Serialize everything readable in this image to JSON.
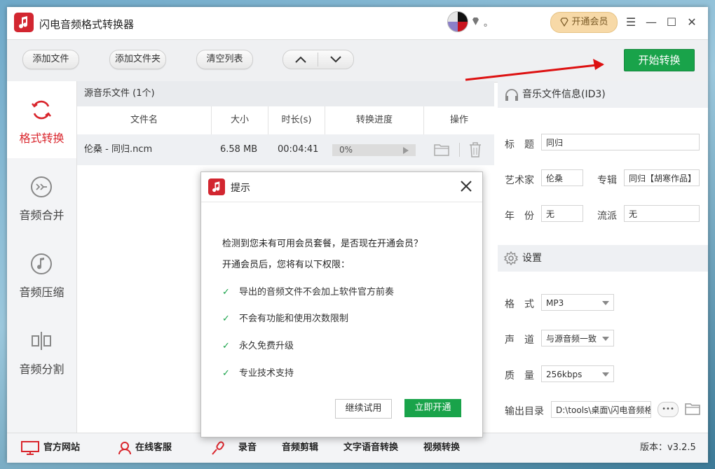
{
  "app": {
    "title": "闪电音频格式转换器",
    "user_name": "。",
    "open_vip_label": "开通会员"
  },
  "window_controls": {
    "menu": "☰",
    "minimize": "—",
    "maximize": "☐",
    "close": "✕"
  },
  "toolbar": {
    "add_file": "添加文件",
    "add_folder": "添加文件夹",
    "clear_list": "清空列表",
    "start_convert": "开始转换"
  },
  "sidebar": {
    "items": [
      {
        "label": "格式转换",
        "icon": "refresh-icon",
        "active": true
      },
      {
        "label": "音频合并",
        "icon": "merge-icon",
        "active": false
      },
      {
        "label": "音频压缩",
        "icon": "music-note-icon",
        "active": false
      },
      {
        "label": "音频分割",
        "icon": "split-icon",
        "active": false
      }
    ]
  },
  "file_pane": {
    "header": "源音乐文件 (1个)",
    "columns": [
      "文件名",
      "大小",
      "时长(s)",
      "转换进度",
      "操作"
    ],
    "rows": [
      {
        "name": "伦桑 - 同归.ncm",
        "size": "6.58 MB",
        "duration": "00:04:41",
        "progress": "0%"
      }
    ]
  },
  "id3": {
    "header": "音乐文件信息(ID3)",
    "title_label": "标　题",
    "title_value": "同归",
    "artist_label": "艺术家",
    "artist_value": "伦桑",
    "album_label": "专辑",
    "album_value": "同归【胡寒作品】",
    "year_label": "年　份",
    "year_value": "无",
    "genre_label": "流派",
    "genre_value": "无"
  },
  "settings": {
    "header": "设置",
    "format_label": "格　式",
    "format_value": "MP3",
    "channel_label": "声　道",
    "channel_value": "与源音频一致",
    "quality_label": "质　量",
    "quality_value": "256kbps",
    "output_label": "输出目录",
    "output_value": "D:\\tools\\桌面\\闪电音频格",
    "more_label": "•••"
  },
  "bottom": {
    "website": "官方网站",
    "support": "在线客服",
    "record": "录音",
    "audio_edit": "音频剪辑",
    "tts": "文字语音转换",
    "video": "视频转换",
    "version": "版本：v3.2.5"
  },
  "dialog": {
    "title": "提示",
    "line1": "检测到您未有可用会员套餐，是否现在开通会员？",
    "line2": "开通会员后，您将有以下权限：",
    "perks": [
      "导出的音频文件不会加上软件官方前奏",
      "不会有功能和使用次数限制",
      "永久免费升级",
      "专业技术支持"
    ],
    "trial_button": "继续试用",
    "open_button": "立即开通"
  },
  "colors": {
    "accent_red": "#d9252c",
    "accent_green": "#19a34a",
    "vip_gold": "#f7d9a7"
  }
}
